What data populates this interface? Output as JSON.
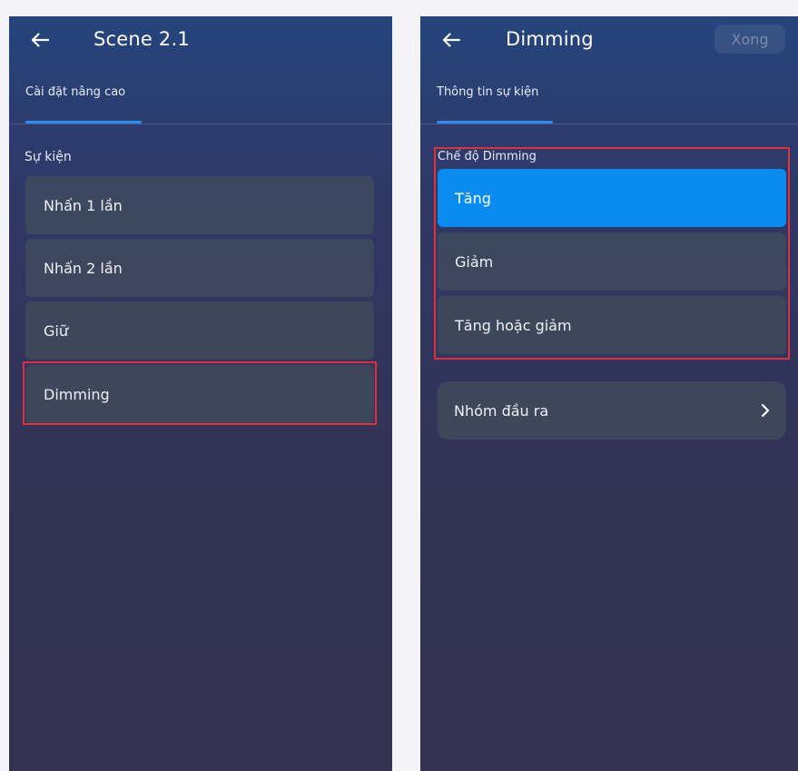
{
  "left_screen": {
    "header": {
      "title": "Scene 2.1",
      "back_icon": "arrow-left-icon"
    },
    "tab": {
      "label": "Cài đặt nâng cao"
    },
    "section": {
      "label": "Sự kiện"
    },
    "items": [
      {
        "label": "Nhấn 1 lần"
      },
      {
        "label": "Nhấn 2 lần"
      },
      {
        "label": "Giữ"
      },
      {
        "label": "Dimming"
      }
    ]
  },
  "right_screen": {
    "header": {
      "title": "Dimming",
      "back_icon": "arrow-left-icon",
      "done_label": "Xong"
    },
    "tab": {
      "label": "Thông tin sự kiện"
    },
    "section": {
      "label": "Chế độ Dimming"
    },
    "options": [
      {
        "label": "Tăng",
        "selected": true
      },
      {
        "label": "Giảm",
        "selected": false
      },
      {
        "label": "Tăng hoặc giảm",
        "selected": false
      }
    ],
    "group_row": {
      "label": "Nhóm đầu ra",
      "icon": "chevron-right-icon"
    }
  },
  "colors": {
    "accent": "#2f8cf0",
    "selected_bg": "#0a8bef",
    "highlight_border": "#e0303c"
  }
}
